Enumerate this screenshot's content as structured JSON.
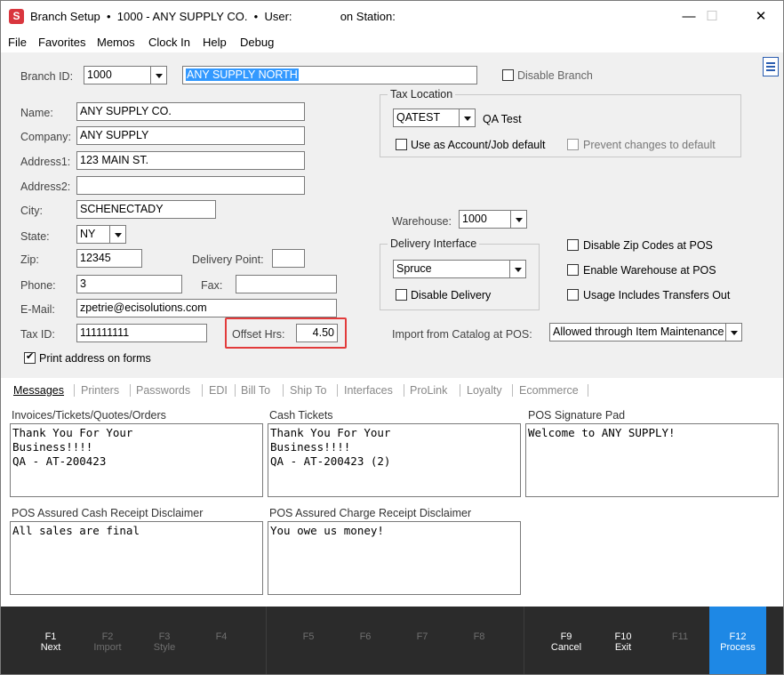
{
  "window": {
    "title": "Branch Setup  •  1000 - ANY SUPPLY CO.  •  User:               on Station:",
    "minimize": "—",
    "maximize": "☐",
    "close": "✕",
    "app_icon": "S"
  },
  "menu": [
    "File",
    "Favorites",
    "Memos",
    "Clock In",
    "Help",
    "Debug"
  ],
  "branch": {
    "id_label": "Branch ID:",
    "id_value": "1000",
    "name_value": "ANY SUPPLY NORTH",
    "disable_label": "Disable Branch"
  },
  "address": {
    "name_label": "Name:",
    "name": "ANY SUPPLY CO.",
    "company_label": "Company:",
    "company": "ANY SUPPLY",
    "address1_label": "Address1:",
    "address1": "123 MAIN ST.",
    "address2_label": "Address2:",
    "address2": "",
    "city_label": "City:",
    "city": "SCHENECTADY",
    "state_label": "State:",
    "state": "NY",
    "zip_label": "Zip:",
    "zip": "12345",
    "delivery_point_label": "Delivery Point:",
    "delivery_point": "",
    "phone_label": "Phone:",
    "phone": "3",
    "fax_label": "Fax:",
    "fax": "",
    "email_label": "E-Mail:",
    "email": "zpetrie@ecisolutions.com",
    "taxid_label": "Tax ID:",
    "taxid": "111111111",
    "offset_label": "Offset Hrs:",
    "offset": "4.50",
    "print_address_label": "Print address on forms"
  },
  "tax_location": {
    "title": "Tax Location",
    "code": "QATEST",
    "desc": "QA Test",
    "use_default_label": "Use as Account/Job default",
    "prevent_label": "Prevent changes to default"
  },
  "warehouse": {
    "label": "Warehouse:",
    "value": "1000"
  },
  "delivery": {
    "title": "Delivery Interface",
    "value": "Spruce",
    "disable_label": "Disable Delivery"
  },
  "pos_options": {
    "disable_zip": "Disable Zip Codes at POS",
    "enable_warehouse": "Enable Warehouse at POS",
    "usage_transfers": "Usage Includes Transfers Out"
  },
  "import_catalog": {
    "label": "Import from Catalog at POS:",
    "value": "Allowed through Item Maintenance"
  },
  "tabs": [
    "Messages",
    "Printers",
    "Passwords",
    "EDI",
    "Bill To",
    "Ship To",
    "Interfaces",
    "ProLink",
    "Loyalty",
    "Ecommerce"
  ],
  "messages": {
    "invoices_label": "Invoices/Tickets/Quotes/Orders",
    "invoices": "Thank You For Your\nBusiness!!!!\nQA - AT-200423",
    "cash_label": "Cash Tickets",
    "cash": "Thank You For Your\nBusiness!!!!\nQA - AT-200423 (2)",
    "signature_label": "POS Signature Pad",
    "signature": "Welcome to ANY SUPPLY!",
    "cash_disclaimer_label": "POS Assured Cash Receipt Disclaimer",
    "cash_disclaimer": "All sales are final",
    "charge_disclaimer_label": "POS Assured Charge Receipt Disclaimer",
    "charge_disclaimer": "You owe us money!"
  },
  "fkeys": [
    {
      "key": "F1",
      "name": "Next"
    },
    {
      "key": "F2",
      "name": "Import"
    },
    {
      "key": "F3",
      "name": "Style"
    },
    {
      "key": "F4",
      "name": ""
    },
    {
      "key": "F5",
      "name": ""
    },
    {
      "key": "F6",
      "name": ""
    },
    {
      "key": "F7",
      "name": ""
    },
    {
      "key": "F8",
      "name": ""
    },
    {
      "key": "F9",
      "name": "Cancel"
    },
    {
      "key": "F10",
      "name": "Exit"
    },
    {
      "key": "F11",
      "name": ""
    },
    {
      "key": "F12",
      "name": "Process"
    }
  ],
  "colors": {
    "accent": "#1e88e5",
    "highlight": "#e23b3b",
    "selection": "#3399ff"
  }
}
